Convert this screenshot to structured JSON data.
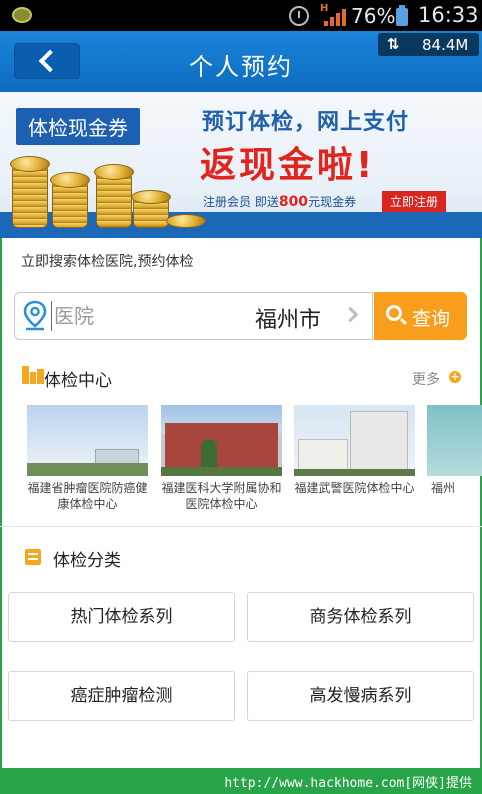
{
  "status_bar": {
    "network_indicator": "H",
    "battery_percent": "76%",
    "time": "16:33"
  },
  "header": {
    "title": "个人预约",
    "back_icon": "chevron-left-icon",
    "speed_icon": "data-transfer-icon",
    "network_speed": "84.4M",
    "color": "#1478cc"
  },
  "banner": {
    "tag": "体检现金券",
    "line1": "预订体检，网上支付",
    "line2": "返现金啦!",
    "line3_prefix": "注册会员  即送",
    "line3_amount": "800",
    "line3_suffix": "元现金券",
    "register_button": "立即注册",
    "slide_count": 5,
    "active_slide": 0
  },
  "search": {
    "hint": "立即搜索体检医院,预约体检",
    "placeholder": "医院",
    "value": "",
    "city": "福州市",
    "button_label": "查询",
    "button_color": "#f99d1c"
  },
  "centers": {
    "title": "体检中心",
    "more_label": "更多",
    "items": [
      {
        "name": "福建省肿瘤医院防癌健康体检中心"
      },
      {
        "name": "福建医科大学附属协和医院体检中心"
      },
      {
        "name": "福建武警医院体检中心"
      },
      {
        "name": "福州"
      }
    ]
  },
  "categories": {
    "title": "体检分类",
    "items": [
      {
        "label": "热门体检系列"
      },
      {
        "label": "商务体检系列"
      },
      {
        "label": "癌症肿瘤检测"
      },
      {
        "label": "高发慢病系列"
      }
    ]
  },
  "footer": {
    "text": "http://www.hackhome.com[网侠]提供",
    "color": "#27a548"
  }
}
